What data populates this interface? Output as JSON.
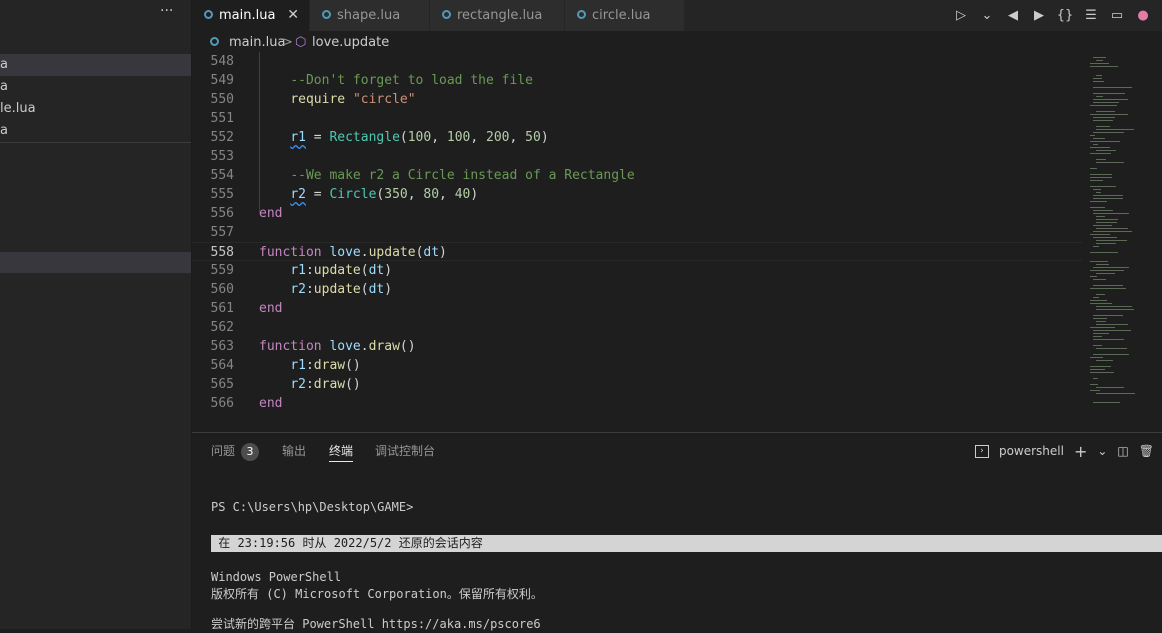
{
  "sidebar": {
    "more_label": "···",
    "files": [
      "a",
      "a",
      "le.lua",
      "a"
    ]
  },
  "tabs": [
    {
      "label": "main.lua",
      "active": true,
      "close": "✕"
    },
    {
      "label": "shape.lua",
      "active": false
    },
    {
      "label": "rectangle.lua",
      "active": false
    },
    {
      "label": "circle.lua",
      "active": false
    }
  ],
  "editor_actions": [
    "run-icon",
    "chevron-down-icon",
    "back-icon",
    "forward-icon",
    "braces-icon",
    "list-icon",
    "terminal-icon",
    "extension-icon"
  ],
  "breadcrumb": {
    "file": "main.lua",
    "separator": ">",
    "symbol": "love.update"
  },
  "code": {
    "lines": [
      {
        "n": "548",
        "text": ""
      },
      {
        "n": "549",
        "text": "    --Don't forget to load the file"
      },
      {
        "n": "550",
        "text": "    require \"circle\""
      },
      {
        "n": "551",
        "text": ""
      },
      {
        "n": "552",
        "text": "    r1 = Rectangle(100, 100, 200, 50)"
      },
      {
        "n": "553",
        "text": ""
      },
      {
        "n": "554",
        "text": "    --We make r2 a Circle instead of a Rectangle"
      },
      {
        "n": "555",
        "text": "    r2 = Circle(350, 80, 40)"
      },
      {
        "n": "556",
        "text": "end"
      },
      {
        "n": "557",
        "text": ""
      },
      {
        "n": "558",
        "text": "function love.update(dt)"
      },
      {
        "n": "559",
        "text": "    r1:update(dt)"
      },
      {
        "n": "560",
        "text": "    r2:update(dt)"
      },
      {
        "n": "561",
        "text": "end"
      },
      {
        "n": "562",
        "text": ""
      },
      {
        "n": "563",
        "text": "function love.draw()"
      },
      {
        "n": "564",
        "text": "    r1:draw()"
      },
      {
        "n": "565",
        "text": "    r2:draw()"
      },
      {
        "n": "566",
        "text": "end"
      }
    ],
    "current_line": "558"
  },
  "panel": {
    "tabs": [
      {
        "label": "问题",
        "badge": "3"
      },
      {
        "label": "输出"
      },
      {
        "label": "终端",
        "active": true
      },
      {
        "label": "调试控制台"
      }
    ],
    "shell_label": "powershell",
    "actions": [
      "plus-icon",
      "chevron-down-icon",
      "split-icon",
      "trash-icon"
    ]
  },
  "terminal": {
    "prompt": "PS C:\\Users\\hp\\Desktop\\GAME>",
    "restored": " 在 23:19:56 时从 2022/5/2 还原的会话内容",
    "line1": "Windows PowerShell",
    "line2": "版权所有 (C) Microsoft Corporation。保留所有权利。",
    "line3": "尝试新的跨平台 PowerShell https://aka.ms/pscore6"
  },
  "colors": {
    "background": "#1e1e1e",
    "sidebar": "#252526",
    "keyword": "#c586c0",
    "variable": "#9cdcfe",
    "function": "#dcdcaa",
    "class": "#4ec9b0",
    "string": "#ce9178",
    "number": "#b5cea8",
    "comment": "#6a9955"
  }
}
